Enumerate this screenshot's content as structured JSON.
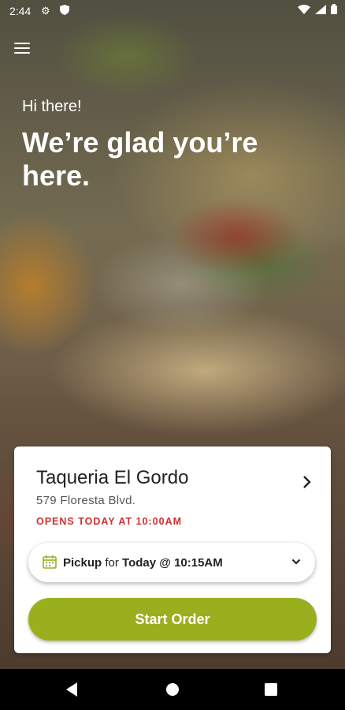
{
  "status_bar": {
    "time": "2:44"
  },
  "hero": {
    "greeting": "Hi there!",
    "headline": "We’re glad you’re here."
  },
  "store": {
    "name": "Taqueria El Gordo",
    "address": "579 Floresta Blvd.",
    "hours_status": "OPENS TODAY AT 10:00AM"
  },
  "pickup": {
    "mode": "Pickup",
    "for_word": "for",
    "time": "Today @ 10:15AM"
  },
  "actions": {
    "start_order": "Start Order"
  },
  "colors": {
    "accent": "#9aaf1d",
    "alert": "#d32f2f"
  }
}
